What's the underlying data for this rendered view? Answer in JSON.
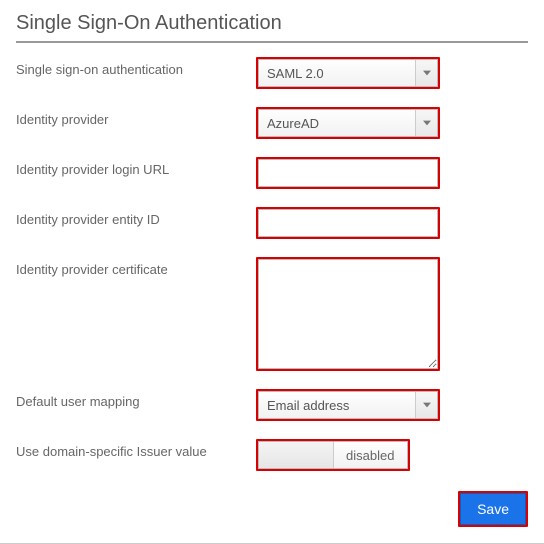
{
  "title": "Single Sign-On Authentication",
  "labels": {
    "auth": "Single sign-on authentication",
    "idp": "Identity provider",
    "login_url": "Identity provider login URL",
    "entity_id": "Identity provider entity ID",
    "cert": "Identity provider certificate",
    "default_mapping": "Default user mapping",
    "domain_issuer": "Use domain-specific Issuer value"
  },
  "values": {
    "auth": "SAML 2.0",
    "idp": "AzureAD",
    "login_url": "",
    "entity_id": "",
    "cert": "",
    "default_mapping": "Email address",
    "domain_issuer": "disabled"
  },
  "buttons": {
    "save": "Save"
  }
}
